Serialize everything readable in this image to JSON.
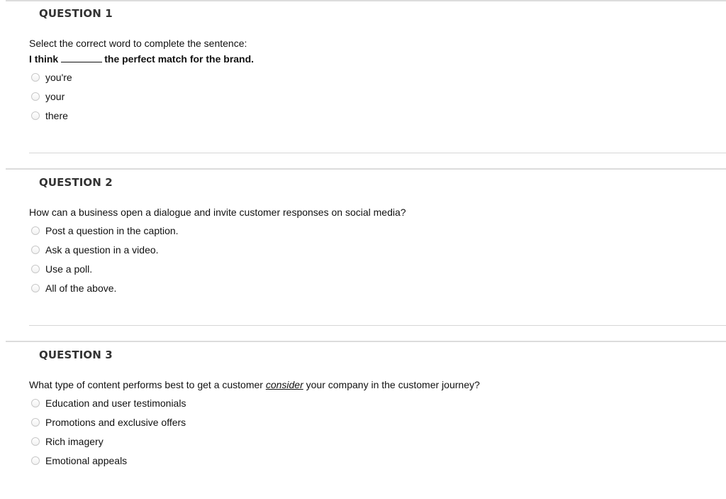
{
  "questions": [
    {
      "title": "QUESTION 1",
      "prompt_line1": "Select the correct word to complete the sentence:",
      "prompt_bold_before": "I think",
      "prompt_bold_after": "the perfect match for the brand.",
      "options": [
        "you're",
        "your",
        "there"
      ]
    },
    {
      "title": "QUESTION 2",
      "prompt": "How can a business open a dialogue and invite customer responses on social media?",
      "options": [
        "Post a question in the caption.",
        "Ask a question in a video.",
        "Use a poll.",
        "All of the above."
      ]
    },
    {
      "title": "QUESTION 3",
      "prompt_before": "What type of content performs best to get a customer ",
      "prompt_emphasis": "consider",
      "prompt_after": " your company in the customer journey?",
      "options": [
        "Education and user testimonials",
        "Promotions and exclusive offers",
        "Rich imagery",
        "Emotional appeals"
      ]
    }
  ]
}
